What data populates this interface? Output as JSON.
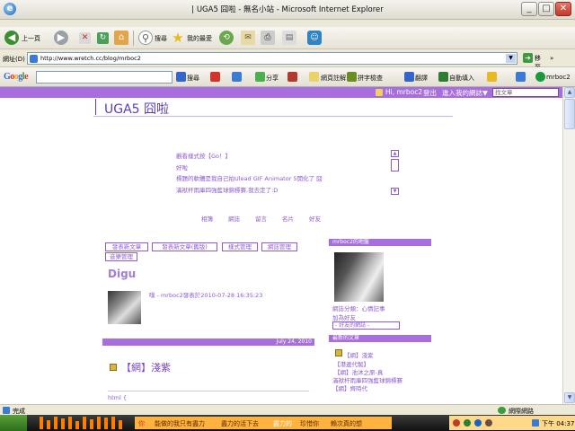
{
  "window": {
    "title": "| UGA5 囧啦 - 無名小站 - Microsoft Internet Explorer",
    "minimize": "_",
    "maximize": "□",
    "close": "✕"
  },
  "toolbar": {
    "back_label": "上一頁",
    "search_label": "搜尋",
    "favorites_label": "我的最愛"
  },
  "address": {
    "label": "網址(D)",
    "url": "http://www.wretch.cc/blog/mrboc2",
    "go_label": "移至",
    "links_label": "»"
  },
  "google_bar": {
    "logo": "Google",
    "search_btn": "搜尋",
    "share": "分享",
    "bookmark": "網頁註解",
    "spellcheck": "拼字檢查",
    "translate": "翻譯",
    "autofill": "自動填入",
    "user": "mrboc2"
  },
  "site_strip": {
    "greeting": "Hi, mrboc2",
    "logout": "登出",
    "my_site": "進入我的網誌▼",
    "search_placeholder": "找文章"
  },
  "blog": {
    "title": "UGA5 囧啦",
    "marquee": [
      "觀看樣式按【Go！】",
      "好啦",
      "標題的軟體是我自己拍Ulead GIF Animator 5開化了 囧",
      "滿袱杆雨庫四強藍球錦標賽,我去定了:D"
    ],
    "nav": [
      "相簿",
      "網誌",
      "留言",
      "名片",
      "好友"
    ],
    "manage_buttons": [
      "發表新文章",
      "發表新文章(舊版)",
      "樣式管理",
      "網誌管理",
      "音樂管理"
    ],
    "digu_heading": "Digu",
    "post_meta": "噗 - mrboc2發表於2010-07-28 16:35:23",
    "date": "July 24, 2010",
    "post_title": "【網】淺紫",
    "post_body_start": "html {"
  },
  "sidebar": {
    "map_header": "mrboc2的地盤",
    "blog_category": "網誌分類：心情記事",
    "add_friend": "加為好友",
    "friends_select": "- 好友的網誌 -",
    "recent_header": "最新的文章",
    "recent": [
      "【網】淺紫",
      "【港邊代製】",
      "【網】池沐之原-真",
      "滿袱杆雨庫四強藍球錦標賽",
      "【網】齊時代"
    ]
  },
  "status": {
    "left": "完成",
    "zone": "網際網路"
  },
  "taskbar": {
    "ticker": [
      "你",
      "能做的我只有盡力",
      "盡力的活下去",
      "盡力的",
      "珍惜你",
      "賴次真的想"
    ],
    "clock": "下午 04:37"
  },
  "colors": {
    "accent": "#a86ee0",
    "link": "#8d5bd0"
  }
}
